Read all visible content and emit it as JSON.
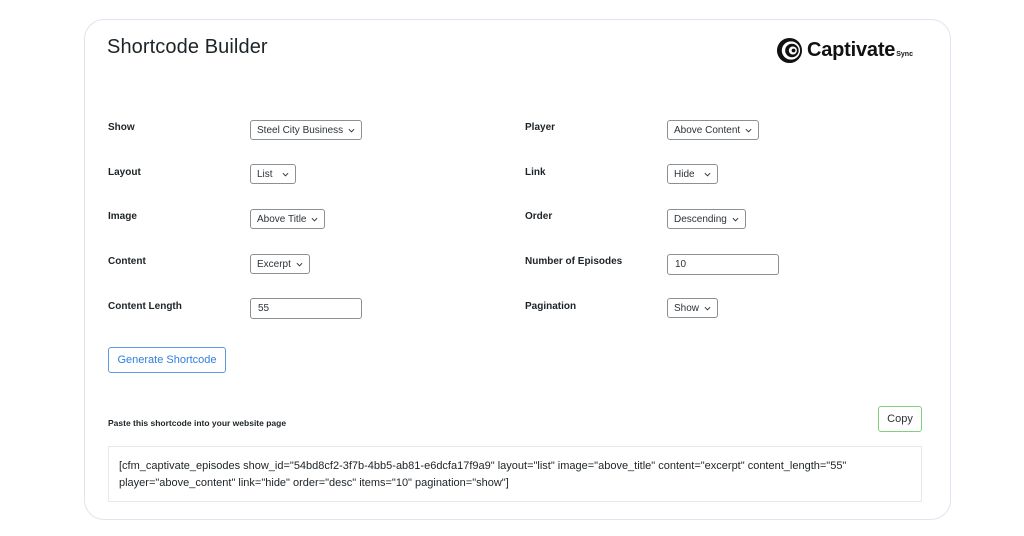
{
  "header": {
    "title": "Shortcode Builder",
    "logo_word": "Captivate",
    "logo_sub": "Sync"
  },
  "left_fields": [
    {
      "label": "Show",
      "type": "select",
      "value": "Steel City Business"
    },
    {
      "label": "Layout",
      "type": "select",
      "value": "List"
    },
    {
      "label": "Image",
      "type": "select",
      "value": "Above Title"
    },
    {
      "label": "Content",
      "type": "select",
      "value": "Excerpt"
    },
    {
      "label": "Content Length",
      "type": "input",
      "value": "55"
    }
  ],
  "right_fields": [
    {
      "label": "Player",
      "type": "select",
      "value": "Above Content"
    },
    {
      "label": "Link",
      "type": "select",
      "value": "Hide"
    },
    {
      "label": "Order",
      "type": "select",
      "value": "Descending"
    },
    {
      "label": "Number of Episodes",
      "type": "input",
      "value": "10"
    },
    {
      "label": "Pagination",
      "type": "select",
      "value": "Show"
    }
  ],
  "actions": {
    "generate_label": "Generate Shortcode",
    "paste_label": "Paste this shortcode into your website page",
    "copy_label": "Copy"
  },
  "shortcode": {
    "line1": "[cfm_captivate_episodes show_id=\"54bd8cf2-3f7b-4bb5-ab81-e6dcfa17f9a9\" layout=\"list\" image=\"above_title\" content=\"excerpt\" content_length=\"55\"",
    "line2": "player=\"above_content\" link=\"hide\" order=\"desc\" items=\"10\" pagination=\"show\"]"
  },
  "colors": {
    "accent": "#2f7fe0",
    "copy_border": "#7fcf7f"
  }
}
